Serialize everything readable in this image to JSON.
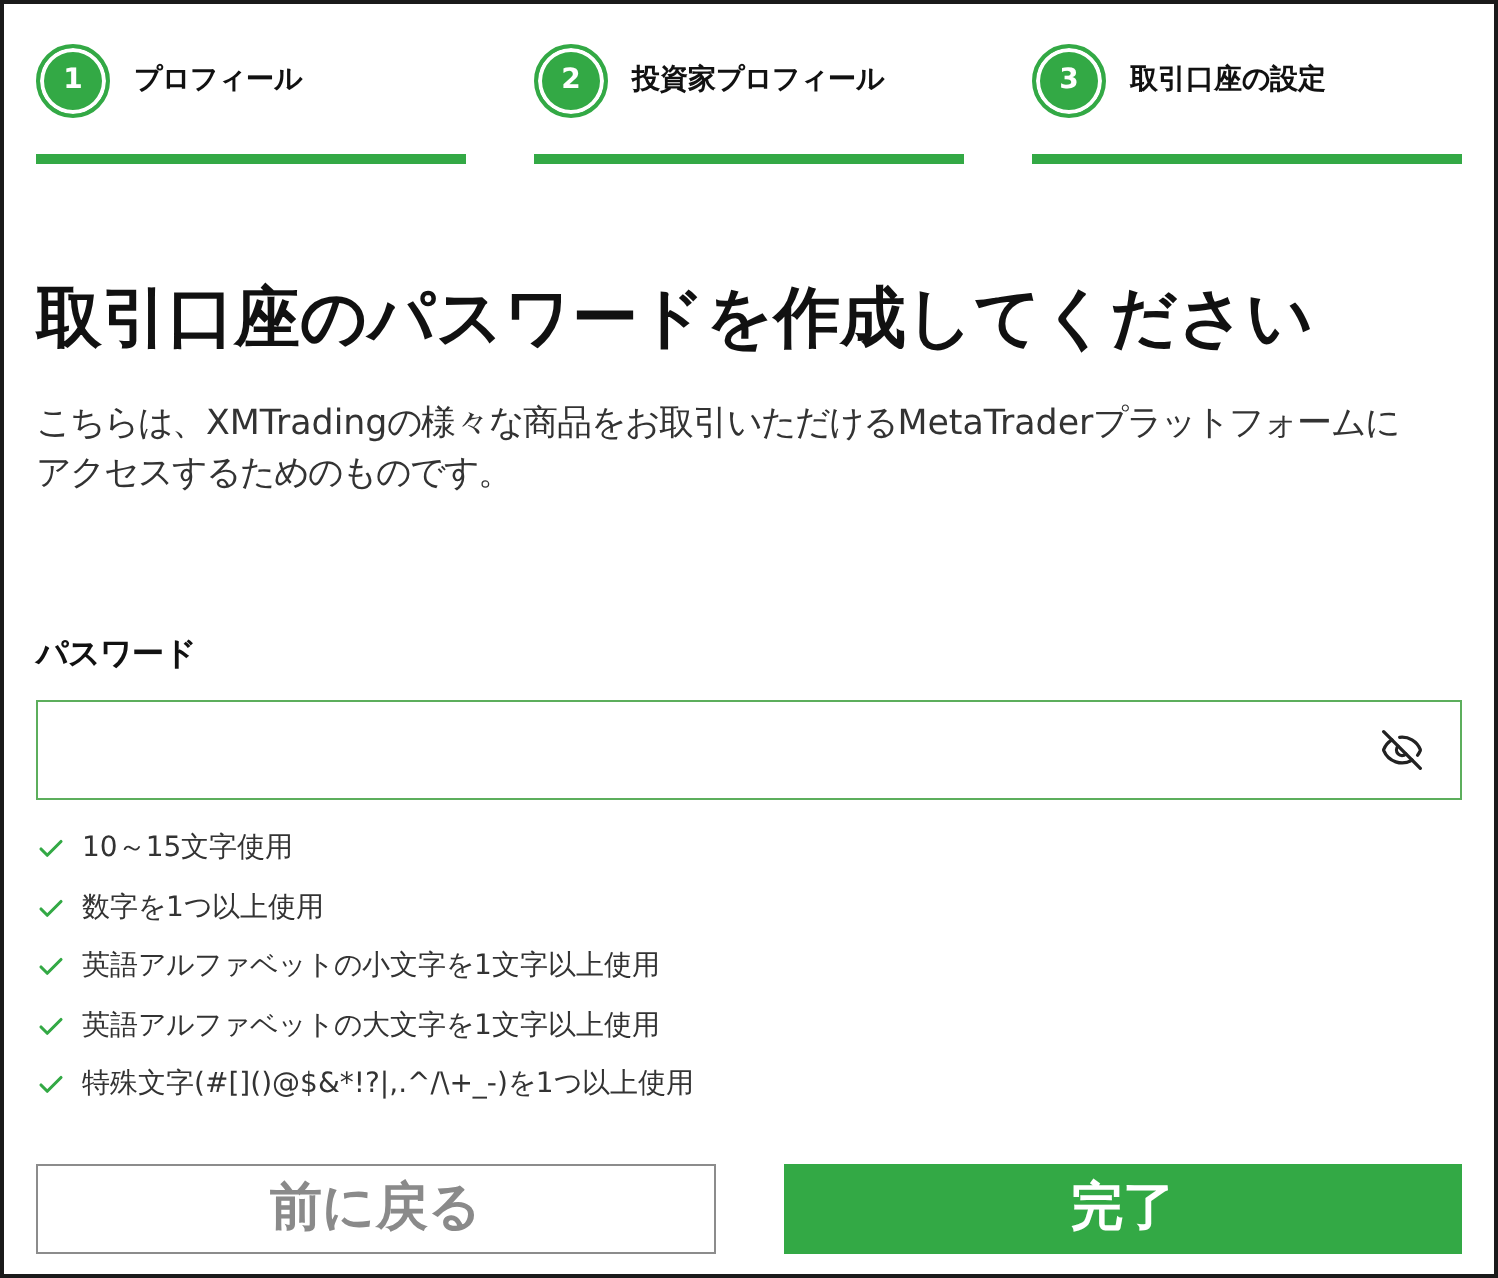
{
  "steps": [
    {
      "number": "1",
      "label": "プロフィール",
      "completed": true
    },
    {
      "number": "2",
      "label": "投資家プロフィール",
      "completed": true
    },
    {
      "number": "3",
      "label": "取引口座の設定",
      "completed": true
    }
  ],
  "title": "取引口座のパスワードを作成してください",
  "description": "こちらは、XMTradingの様々な商品をお取引いただけるMetaTraderプラットフォームにアクセスするためのものです。",
  "password_field": {
    "label": "パスワード"
  },
  "requirements": [
    {
      "text": "10～15文字使用",
      "met": true
    },
    {
      "text": "数字を1つ以上使用",
      "met": true
    },
    {
      "text": "英語アルファベットの小文字を1文字以上使用",
      "met": true
    },
    {
      "text": "英語アルファベットの大文字を1文字以上使用",
      "met": true
    },
    {
      "text": "特殊文字(#[]()@$&*!?|,.^/\\+_-)を1つ以上使用",
      "met": true
    }
  ],
  "buttons": [
    {
      "label": "前に戻る",
      "kind": "secondary"
    },
    {
      "label": "完了",
      "kind": "primary"
    }
  ]
}
